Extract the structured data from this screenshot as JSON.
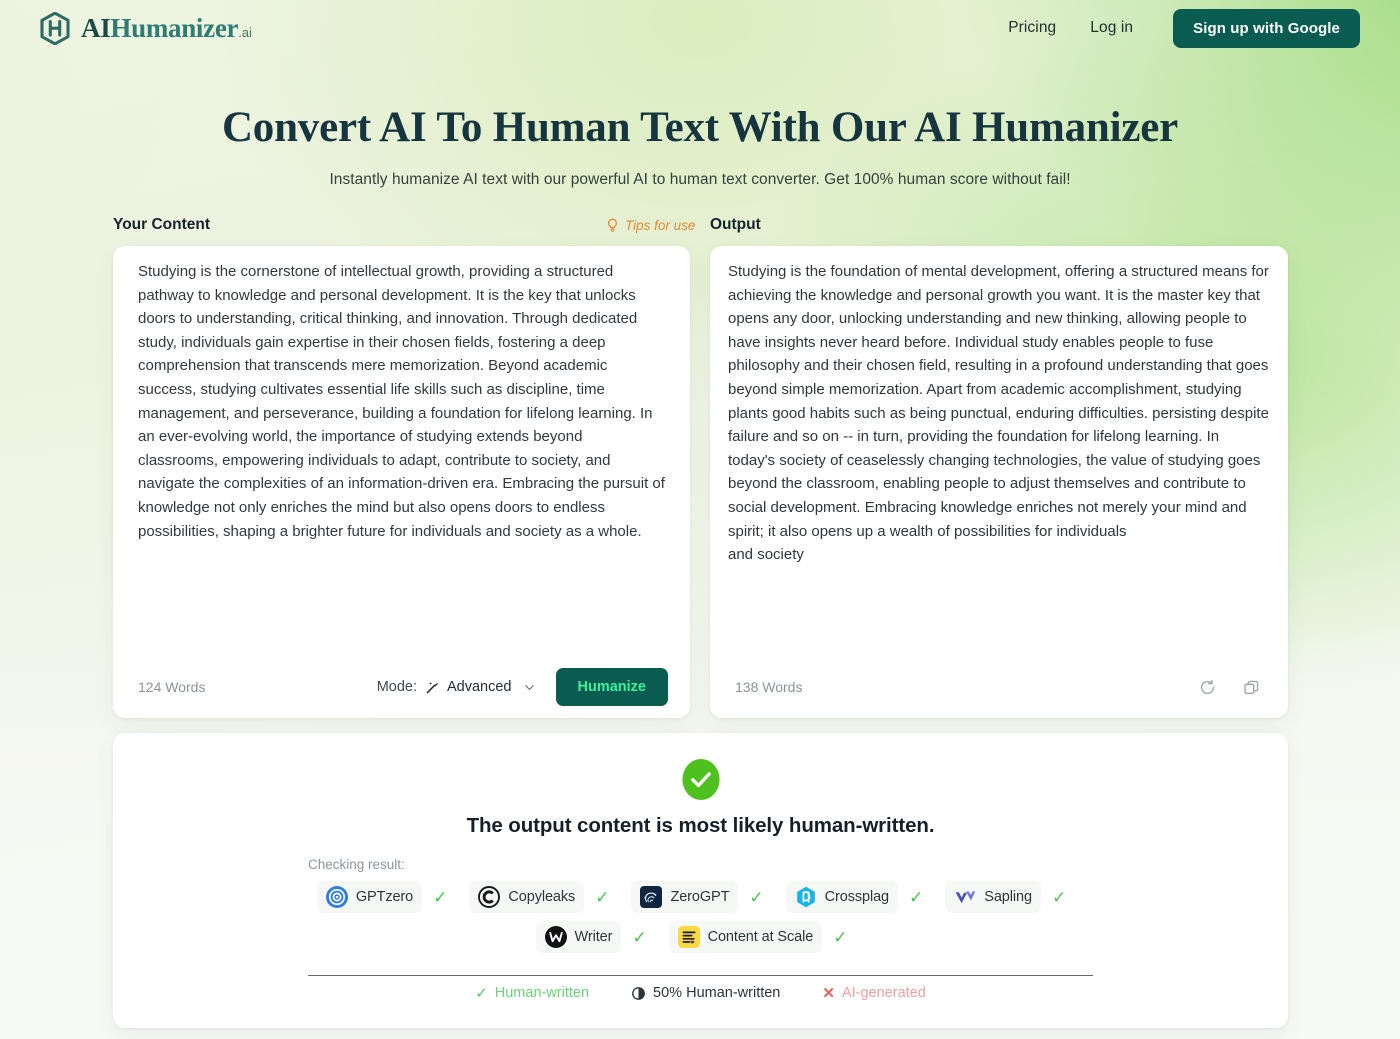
{
  "header": {
    "logo_name": "AI",
    "logo_name2": "Humanizer",
    "logo_suffix": ".ai",
    "nav": [
      {
        "label": "Pricing"
      },
      {
        "label": "Log in"
      }
    ],
    "signup_label": "Sign up with Google"
  },
  "hero": {
    "title": "Convert AI To Human Text With Our AI Humanizer",
    "subtitle": "Instantly humanize AI text with our powerful AI to human text converter. Get 100% human score without fail!"
  },
  "editor": {
    "input_label": "Your Content",
    "tips_label": "Tips for use",
    "output_label": "Output",
    "input_text": "Studying is the cornerstone of intellectual growth, providing a structured pathway to knowledge and personal development. It is the key that unlocks doors to understanding, critical thinking, and innovation. Through dedicated study, individuals gain expertise in their chosen fields, fostering a deep comprehension that transcends mere memorization. Beyond academic success, studying cultivates essential life skills such as discipline, time management, and perseverance, building a foundation for lifelong learning. In an ever-evolving world, the importance of studying extends beyond classrooms, empowering individuals to adapt, contribute to society, and navigate the complexities of an information-driven era. Embracing the pursuit of knowledge not only enriches the mind but also opens doors to endless possibilities, shaping a brighter future for individuals and society as a whole.",
    "output_text": "Studying is the foundation of mental development, offering a structured means for achieving the knowledge and personal growth you want. It is the master key that opens any door, unlocking understanding and new thinking, allowing people to have insights never heard before. Individual study enables people to fuse philosophy and their chosen field, resulting in a profound understanding that goes beyond simple memorization. Apart from academic accomplishment, studying plants good habits such as being punctual, enduring difficulties. persisting despite failure and so on -- in turn, providing the foundation for lifelong learning. In today's society of ceaselessly changing technologies, the value of studying goes beyond the classroom, enabling people to adjust themselves and contribute to social development. Embracing knowledge enriches not merely your mind and spirit; it also opens up a wealth of possibilities for individuals\nand society",
    "input_word_count": "124 Words",
    "output_word_count": "138 Words",
    "mode_label": "Mode:",
    "mode_value": "Advanced",
    "humanize_label": "Humanize"
  },
  "result": {
    "title": "The output content is most likely human-written.",
    "checking_label": "Checking result:",
    "detectors_row1": [
      {
        "name": "GPTzero",
        "icon": "gptzero-icon",
        "status": "pass"
      },
      {
        "name": "Copyleaks",
        "icon": "copyleaks-icon",
        "status": "pass"
      },
      {
        "name": "ZeroGPT",
        "icon": "zerogpt-icon",
        "status": "pass"
      },
      {
        "name": "Crossplag",
        "icon": "crossplag-icon",
        "status": "pass"
      },
      {
        "name": "Sapling",
        "icon": "sapling-icon",
        "status": "pass"
      }
    ],
    "detectors_row2": [
      {
        "name": "Writer",
        "icon": "writer-icon",
        "status": "pass"
      },
      {
        "name": "Content at Scale",
        "icon": "content-at-scale-icon",
        "status": "pass"
      }
    ],
    "legend": [
      {
        "label": "Human-written",
        "glyph": "check"
      },
      {
        "label": "50% Human-written",
        "glyph": "half"
      },
      {
        "label": "AI-generated",
        "glyph": "cross"
      }
    ]
  },
  "colors": {
    "brand_dark": "#0a5c50",
    "brand_accent": "#3ef09a",
    "tips_orange": "#e08a33",
    "pass_green": "#4fbf52",
    "ai_red": "#f0a0a0"
  }
}
